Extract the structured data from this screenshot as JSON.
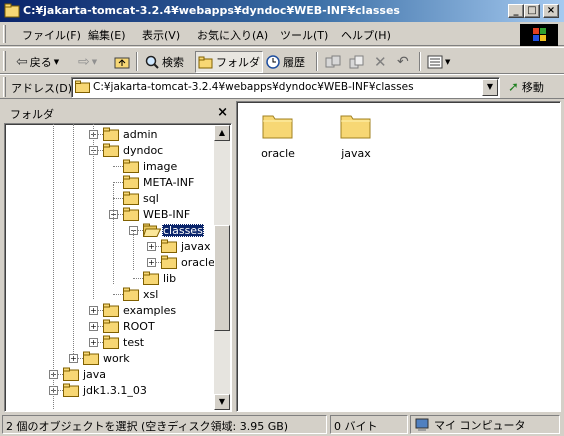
{
  "window": {
    "title": "C:¥jakarta-tomcat-3.2.4¥webapps¥dyndoc¥WEB-INF¥classes",
    "minimize": "_",
    "maximize": "□",
    "close": "×"
  },
  "menu": [
    "ファイル(F)",
    "編集(E)",
    "表示(V)",
    "お気に入り(A)",
    "ツール(T)",
    "ヘルプ(H)"
  ],
  "toolbar": {
    "back_label": "戻る",
    "search_label": "検索",
    "folders_label": "フォルダ",
    "history_label": "履歴"
  },
  "address": {
    "label": "アドレス(D)",
    "value": "C:¥jakarta-tomcat-3.2.4¥webapps¥dyndoc¥WEB-INF¥classes",
    "go_label": "移動"
  },
  "folder_pane": {
    "title": "フォルダ",
    "close": "×",
    "tree": [
      {
        "label": "admin",
        "expander": "+"
      },
      {
        "label": "dyndoc",
        "expander": "−"
      },
      {
        "label": "image",
        "expander": ""
      },
      {
        "label": "META-INF",
        "expander": ""
      },
      {
        "label": "sql",
        "expander": ""
      },
      {
        "label": "WEB-INF",
        "expander": "−"
      },
      {
        "label": "classes",
        "expander": "−"
      },
      {
        "label": "javax",
        "expander": "+"
      },
      {
        "label": "oracle",
        "expander": "+"
      },
      {
        "label": "lib",
        "expander": ""
      },
      {
        "label": "xsl",
        "expander": ""
      },
      {
        "label": "examples",
        "expander": "+"
      },
      {
        "label": "ROOT",
        "expander": "+"
      },
      {
        "label": "test",
        "expander": "+"
      },
      {
        "label": "work",
        "expander": "+"
      },
      {
        "label": "java",
        "expander": "+"
      },
      {
        "label": "jdk1.3.1_03",
        "expander": "+"
      }
    ]
  },
  "content": {
    "items": [
      {
        "label": "oracle"
      },
      {
        "label": "javax"
      }
    ]
  },
  "status": {
    "selection": "2 個のオブジェクトを選択 (空きディスク領域: 3.95 GB)",
    "size": "0 バイト",
    "zone": "マイ コンピュータ"
  },
  "colors": {
    "title_active": "#0a246a",
    "face": "#d4d0c8",
    "selection": "#0a246a",
    "folder": "#f7d774"
  }
}
